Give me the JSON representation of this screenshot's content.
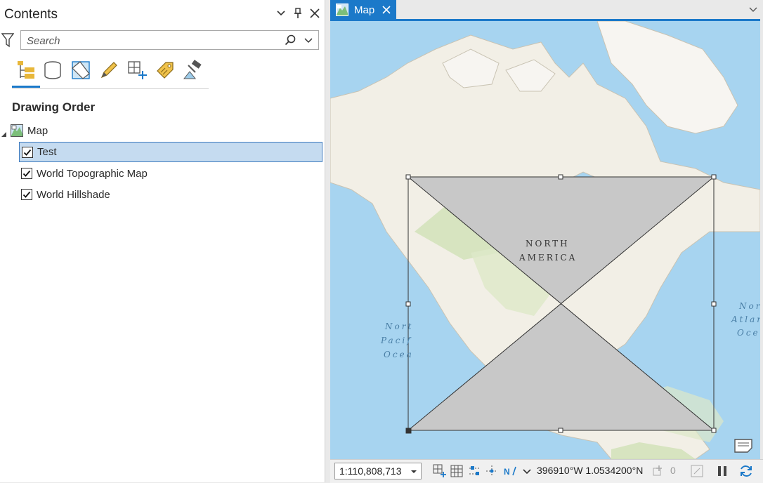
{
  "contents": {
    "title": "Contents",
    "search": {
      "placeholder": "Search"
    },
    "section_heading": "Drawing Order",
    "map_node": "Map",
    "layers": [
      {
        "label": "Test",
        "checked": true,
        "selected": true
      },
      {
        "label": "World Topographic Map",
        "checked": true,
        "selected": false
      },
      {
        "label": "World Hillshade",
        "checked": true,
        "selected": false
      }
    ],
    "toolbar_icons": [
      "list-by-drawing-order-icon",
      "list-by-data-source-icon",
      "list-by-selection-icon",
      "list-by-editing-icon",
      "list-by-snapping-icon",
      "list-by-labeling-icon",
      "list-by-perspective-imagery-icon"
    ]
  },
  "map_tab": {
    "label": "Map"
  },
  "map": {
    "labels": {
      "north": "NORTH",
      "america": "AMERICA",
      "pac1": "Nort",
      "pac2": "Pacif",
      "pac3": "Ocea",
      "atl1": "Nor",
      "atl2": "Atlan",
      "atl3": "Oce"
    }
  },
  "status": {
    "scale": "1:110,808,713",
    "coordinates": "396910°W 1.0534200°N",
    "selected_count": "0"
  },
  "colors": {
    "accent": "#1b79c9",
    "selection_fill": "#c5dbf0",
    "feature_fill": "#c8c8c8",
    "water": "#a7d4f0",
    "land": "#f2efe6"
  }
}
